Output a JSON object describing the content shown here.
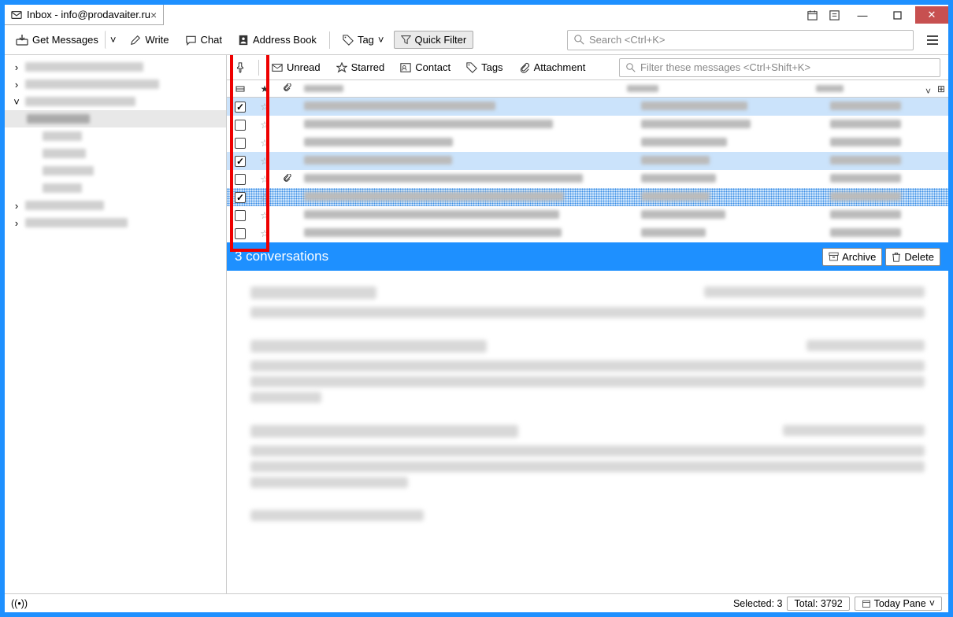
{
  "title": "Inbox - info@prodavaiter.ru",
  "titlebar_icons": [
    "calendar-icon",
    "tasks-icon"
  ],
  "toolbar": {
    "get_messages": "Get Messages",
    "write": "Write",
    "chat": "Chat",
    "address_book": "Address Book",
    "tag": "Tag",
    "quick_filter": "Quick Filter",
    "search_placeholder": "Search <Ctrl+K>"
  },
  "filterbar": {
    "unread": "Unread",
    "starred": "Starred",
    "contact": "Contact",
    "tags": "Tags",
    "attachment": "Attachment",
    "filter_placeholder": "Filter these messages <Ctrl+Shift+K>"
  },
  "columns": {
    "subject_icon": "▪",
    "star_icon": "★",
    "attach_icon": "📎",
    "date_sort": "˅",
    "cfg": "⊞"
  },
  "messages": [
    {
      "checked": true,
      "selected": true,
      "attach": false,
      "star": "☆"
    },
    {
      "checked": false,
      "selected": false,
      "attach": false,
      "star": "☆"
    },
    {
      "checked": false,
      "selected": false,
      "attach": false,
      "star": "☆"
    },
    {
      "checked": true,
      "selected": true,
      "attach": false,
      "star": "☆"
    },
    {
      "checked": false,
      "selected": false,
      "attach": true,
      "star": "☆"
    },
    {
      "checked": true,
      "selected": true,
      "attach": false,
      "star": "☆",
      "dotted": true
    },
    {
      "checked": false,
      "selected": false,
      "attach": false,
      "star": "☆"
    },
    {
      "checked": false,
      "selected": false,
      "attach": false,
      "star": "☆"
    }
  ],
  "conversation_bar": {
    "count_label": "3 conversations",
    "archive": "Archive",
    "delete": "Delete"
  },
  "statusbar": {
    "selected_label": "Selected: 3",
    "total_label": "Total: 3792",
    "today_pane": "Today Pane"
  },
  "annotation": {
    "red_box_region": "selection-checkbox-column"
  }
}
